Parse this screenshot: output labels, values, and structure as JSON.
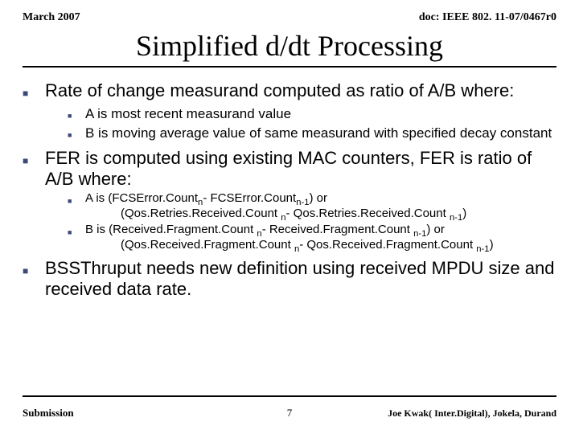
{
  "header": {
    "left": "March 2007",
    "right": "doc: IEEE 802. 11-07/0467r0"
  },
  "title": "Simplified d/dt Processing",
  "bullets": {
    "b1": "Rate of change measurand computed as ratio of A/B where:",
    "b1a": "A is most recent measurand value",
    "b1b": "B is moving average value of same measurand with specified decay constant",
    "b2": "FER is computed using existing MAC counters, FER is ratio of A/B where:",
    "b2a_plain": "A is (FCSError.Count",
    "b2a_mid": "- FCSError.Count",
    "b2a_end": ")   or",
    "b2a_line2_a": "(Qos.Retries.Received.Count ",
    "b2a_line2_b": "- Qos.Retries.Received.Count ",
    "b2a_line2_end": ")",
    "b2b_plain": "B is (Received.Fragment.Count ",
    "b2b_mid": "- Received.Fragment.Count ",
    "b2b_end": ")   or",
    "b2b_line2_a": "(Qos.Received.Fragment.Count ",
    "b2b_line2_b": "- Qos.Received.Fragment.Count ",
    "b2b_line2_end": ")",
    "sub_n": "n",
    "sub_n1": "n-1",
    "b3": "BSSThruput needs new definition using received MPDU size and received data rate."
  },
  "footer": {
    "left": "Submission",
    "center": "7",
    "right": "Joe Kwak( Inter.Digital), Jokela, Durand"
  }
}
